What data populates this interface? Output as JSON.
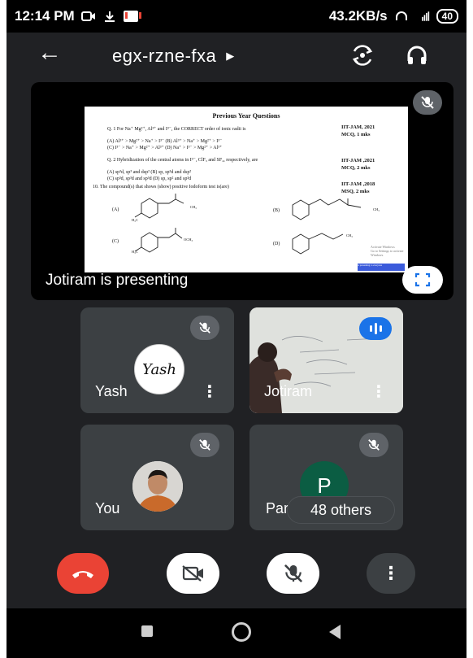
{
  "status_bar": {
    "time": "12:14 PM",
    "net_speed": "43.2KB/s",
    "battery": "40"
  },
  "header": {
    "meeting_code": "egx-rzne-fxa",
    "back_icon": "arrow-left-icon",
    "switch_camera_icon": "switch-camera-icon",
    "audio_icon": "headset-icon"
  },
  "presentation": {
    "label": "Jotiram is presenting",
    "slide": {
      "title": "Previous Year Questions",
      "q1": "Q. 1 For Na⁺ Mg²⁺, Al³⁺ and I³⁻, the CORRECT order of ionic radii is",
      "q1_opt_a": "(A) Al³⁺ > Mg²⁺ > Na⁺ > I³⁻    (B) Al³⁺ > Na⁺ > Mg²⁺ > I³⁻",
      "q1_opt_c": "(C) I³⁻ > Na⁺ > Mg²⁺ > Al³⁺    (D) Na⁺ > I³⁻ > Mg²⁺ > Al³⁺",
      "q1_tag_1": "IIT-JAM, 2021",
      "q1_tag_2": "MCQ, 1 mks",
      "q2": "Q. 2 Hybridization of the central atoms in I³⁻, ClF₃ and SF₄, respectively, are",
      "q2_opt_a": "(A) sp³d, sp³ and dsp²    (B) sp, sp³d and dsp²",
      "q2_opt_c": "(C) sp³d, sp³d and sp³d    (D) sp, sp² and sp³d",
      "q2_tag_1": "IIT-JAM ,2021",
      "q2_tag_2": "MCQ, 2 mks",
      "q3": "10.    The compound(s) that shows (show) positive Iodoform test is(are)",
      "q3_tag_1": "IIT-JAM ,2018",
      "q3_tag_2": "MSQ, 2 mks",
      "opt_a": "(A)",
      "opt_b": "(B)",
      "opt_c": "(C)",
      "opt_d": "(D)",
      "struct_a_sub": "H₃C",
      "struct_a_grp": "CH₃",
      "struct_b_grp": "CH₃",
      "struct_c_sub": "H₃C",
      "struct_c_grp": "OCH₃",
      "struct_d_grp": "CH₃",
      "watermark_1": "Activate Windows",
      "watermark_2": "Go to Settings to activate Windows.",
      "share_text": "is presenting to everyone"
    }
  },
  "participants": [
    {
      "name": "Yash",
      "muted": true,
      "avatar": "Yash"
    },
    {
      "name": "Jotiram",
      "muted": false,
      "speaking": true
    },
    {
      "name": "You",
      "muted": true
    },
    {
      "name": "Par",
      "muted": true,
      "avatar_letter": "P",
      "overflow": "48 others"
    }
  ],
  "controls": {
    "end_call_icon": "end-call-icon",
    "camera_icon": "camera-off-icon",
    "mic_icon": "mic-off-icon",
    "more_icon": "more-vert-icon"
  },
  "colors": {
    "end_call": "#ea4335",
    "speaking": "#1a73e8",
    "tile": "#3c4043",
    "avatar_p": "#0b5d43"
  }
}
